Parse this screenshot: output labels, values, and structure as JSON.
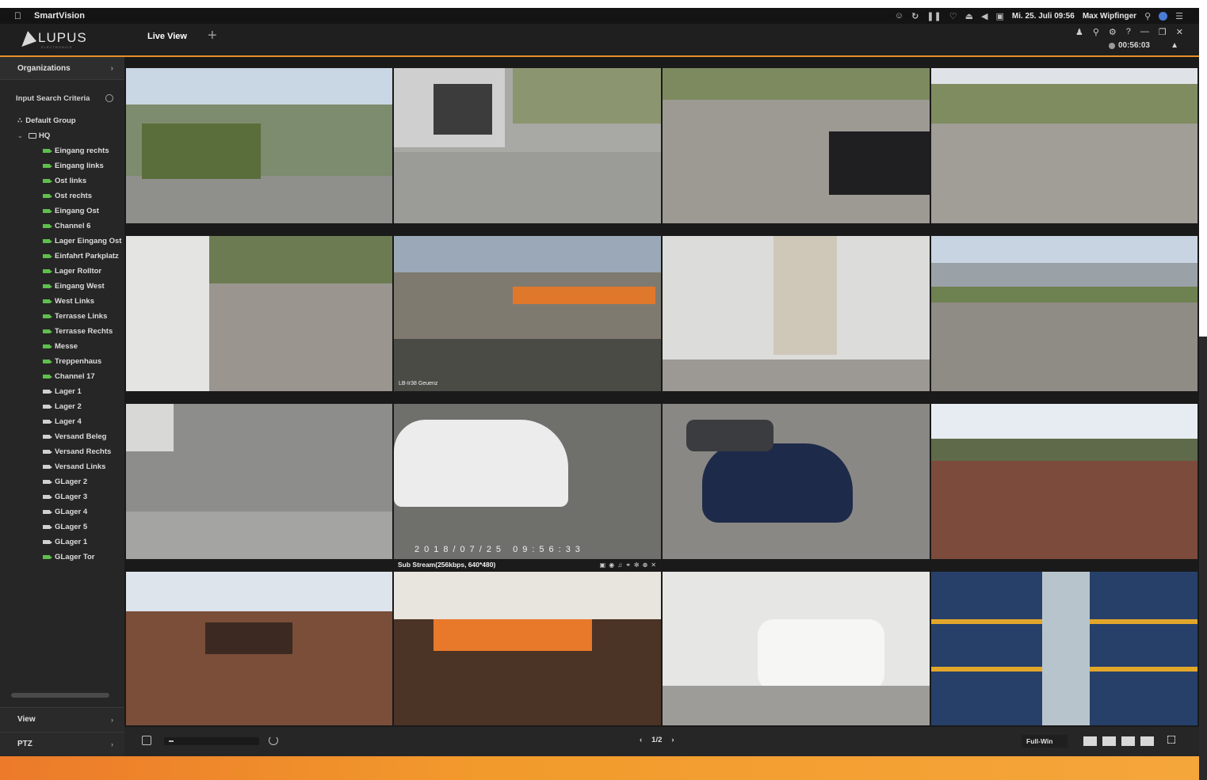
{
  "menubar": {
    "app_name": "SmartVision",
    "status_icons": [
      "accessibility-icon",
      "history-icon",
      "pause-icon",
      "heart-icon",
      "eject-icon",
      "volume-icon",
      "display-icon"
    ],
    "datetime": "Mi. 25. Juli 09:56",
    "user": "Max Wipfinger"
  },
  "header": {
    "logo_text": "LUPUS",
    "logo_subtext": "ELECTRONICS",
    "tab_live": "Live View",
    "tab_add": "+",
    "timer": "00:56:03",
    "window_controls": [
      "user-icon",
      "lock-icon",
      "gear-icon",
      "help-icon",
      "minimize-icon",
      "restore-icon",
      "close-icon"
    ],
    "accent": "#e8902c"
  },
  "sidebar": {
    "organizations_label": "Organizations",
    "search_placeholder": "Input Search Criteria",
    "default_group": "Default Group",
    "hq_label": "HQ",
    "cameras": [
      {
        "name": "Eingang rechts",
        "status": "online"
      },
      {
        "name": "Eingang links",
        "status": "online"
      },
      {
        "name": "Ost links",
        "status": "online"
      },
      {
        "name": "Ost rechts",
        "status": "online"
      },
      {
        "name": "Eingang Ost",
        "status": "online"
      },
      {
        "name": "Channel 6",
        "status": "online"
      },
      {
        "name": "Lager Eingang Ost",
        "status": "online"
      },
      {
        "name": "Einfahrt Parkplatz",
        "status": "online"
      },
      {
        "name": "Lager Rolltor",
        "status": "online"
      },
      {
        "name": "Eingang West",
        "status": "online"
      },
      {
        "name": "West Links",
        "status": "online"
      },
      {
        "name": "Terrasse Links",
        "status": "online"
      },
      {
        "name": "Terrasse Rechts",
        "status": "online"
      },
      {
        "name": "Messe",
        "status": "online"
      },
      {
        "name": "Treppenhaus",
        "status": "online"
      },
      {
        "name": "Channel 17",
        "status": "online"
      },
      {
        "name": "Lager 1",
        "status": "offline"
      },
      {
        "name": "Lager 2",
        "status": "offline"
      },
      {
        "name": "Lager 4",
        "status": "offline"
      },
      {
        "name": "Versand Beleg",
        "status": "offline"
      },
      {
        "name": "Versand Rechts",
        "status": "offline"
      },
      {
        "name": "Versand Links",
        "status": "offline"
      },
      {
        "name": "GLager 2",
        "status": "offline"
      },
      {
        "name": "GLager 3",
        "status": "offline"
      },
      {
        "name": "GLager 4",
        "status": "offline"
      },
      {
        "name": "GLager 5",
        "status": "offline"
      },
      {
        "name": "GLager 1",
        "status": "offline"
      },
      {
        "name": "GLager Tor",
        "status": "online"
      }
    ],
    "view_label": "View",
    "ptz_label": "PTZ"
  },
  "grid": {
    "osd_timestamp": "2018/07/25  09:56:33",
    "substream_label": "Sub Stream(256kbps, 640*480)",
    "tile_overlay_label": "LB-Ir38 Geuenz",
    "substream_tools": [
      "record-icon",
      "snapshot-icon",
      "audio-icon",
      "mic-icon",
      "ptz-icon",
      "zoom-icon",
      "close-icon"
    ]
  },
  "bottom": {
    "page_indicator": "1/2",
    "fullwin_label": "Full-Win"
  }
}
